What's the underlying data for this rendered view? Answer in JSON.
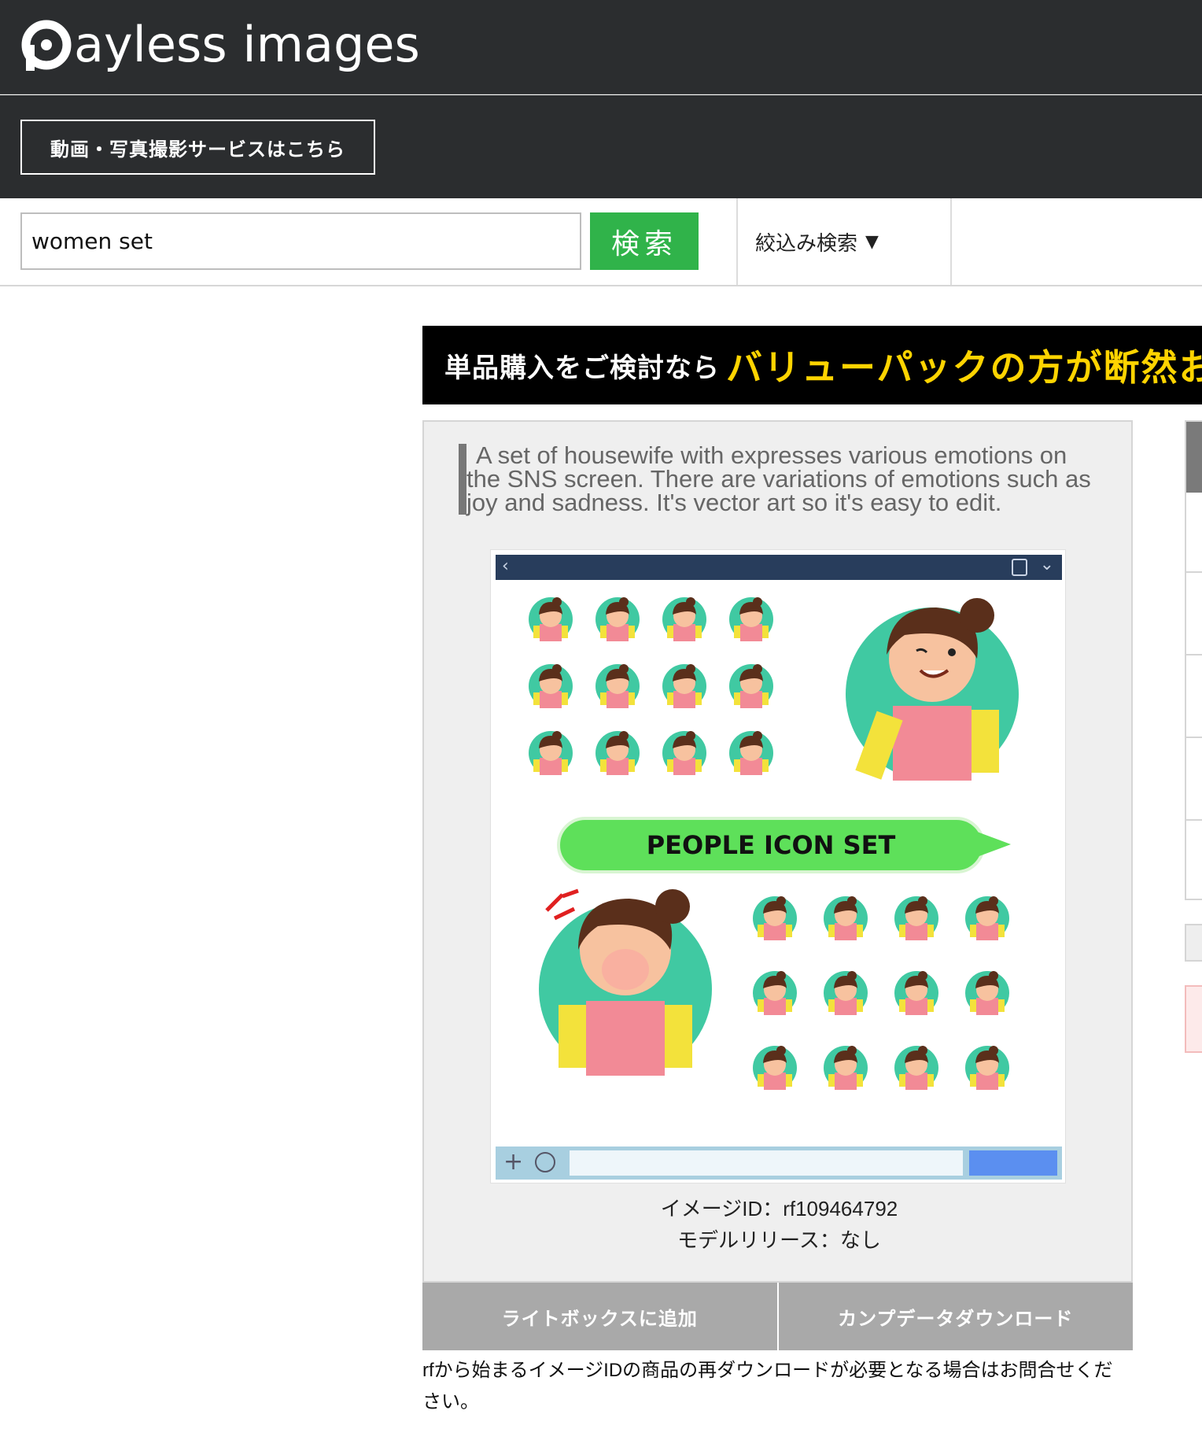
{
  "header": {
    "logo_text": "ayless images",
    "service_button": "動画・写真撮影サービスはこちら"
  },
  "search": {
    "value": "women set",
    "button_label": "検索",
    "filter_label": "絞込み検索",
    "filter_arrow": "▼"
  },
  "promo": {
    "text_white": "単品購入をご検討なら",
    "text_yellow": "バリューパックの方が断然お"
  },
  "product": {
    "description": "A set of housewife with expresses various emotions on the SNS screen. There are variations of emotions such as joy and sadness. It's vector art so it's easy to edit.",
    "preview_banner": "PEOPLE ICON SET",
    "image_id": "イメージID：rf109464792",
    "model_release": "モデルリリース：なし"
  },
  "actions": {
    "lightbox": "ライトボックスに追加",
    "comp_download": "カンプデータダウンロード"
  },
  "note": "rfから始まるイメージIDの商品の再ダウンロードが必要となる場合はお問合せください。",
  "colors": {
    "header_bg": "#2b2d2f",
    "search_green": "#30b34a",
    "promo_yellow": "#ffd400",
    "action_gray": "#a9a9a9"
  }
}
